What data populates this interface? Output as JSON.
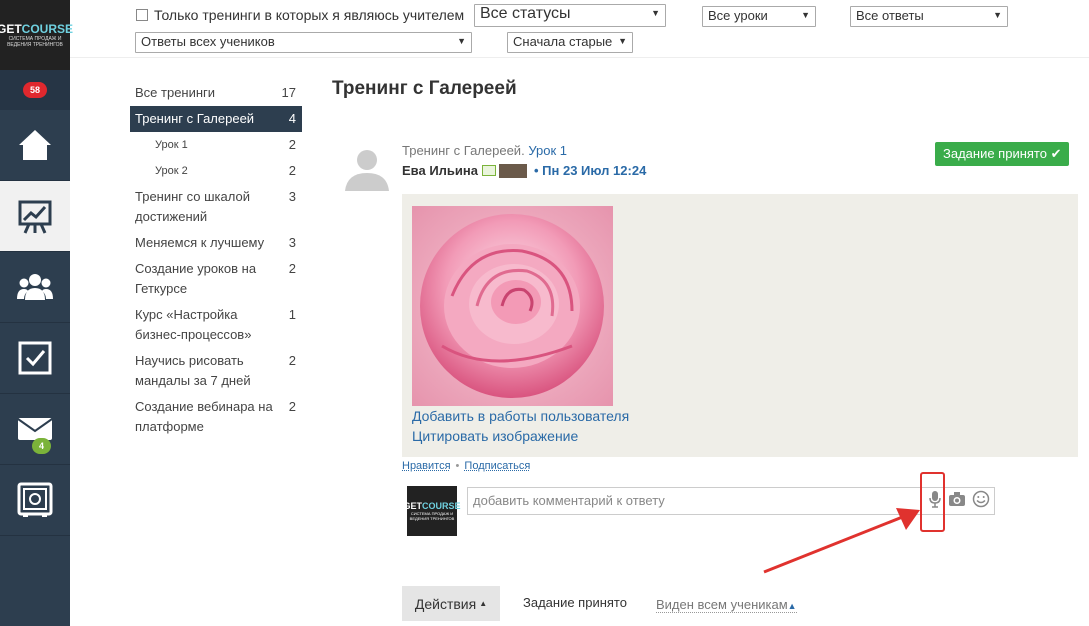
{
  "sidebar": {
    "logo_main": "GET",
    "logo_accent": "COURSE",
    "logo_sub": "СИСТЕМА ПРОДАЖ И ВЕДЕНИЯ ТРЕНИНГОВ",
    "notifications_count": "58",
    "mail_count": "4",
    "items": [
      {
        "icon": "home-icon"
      },
      {
        "icon": "chart-board-icon"
      },
      {
        "icon": "users-icon"
      },
      {
        "icon": "checkbox-icon"
      },
      {
        "icon": "mail-icon"
      },
      {
        "icon": "safe-icon"
      }
    ]
  },
  "filters": {
    "teacher_only_label": "Только тренинги в которых я являюсь учителем",
    "status": "Все статусы",
    "lessons": "Все уроки",
    "answers": "Все ответы",
    "students": "Ответы всех учеников",
    "sort": "Сначала старые"
  },
  "trainings": [
    {
      "label": "Все тренинги",
      "count": "17"
    },
    {
      "label": "Тренинг с Галереей",
      "count": "4"
    },
    {
      "label": "Урок 1",
      "count": "2"
    },
    {
      "label": "Урок 2",
      "count": "2"
    },
    {
      "label": "Тренинг со шкалой достижений",
      "count": "3"
    },
    {
      "label": "Меняемся к лучшему",
      "count": "3"
    },
    {
      "label": "Создание уроков на Геткурсе",
      "count": "2"
    },
    {
      "label": "Курс «Настройка бизнес-процессов»",
      "count": "1"
    },
    {
      "label": "Научись рисовать мандалы за 7 дней",
      "count": "2"
    },
    {
      "label": "Создание вебинара на платформе",
      "count": "2"
    }
  ],
  "page_title": "Тренинг с Галереей",
  "answer": {
    "training": "Тренинг с Галереей.",
    "lesson": "Урок 1",
    "author": "Ева Ильина",
    "datetime": "• Пн 23 Июл 12:24",
    "status_badge": "Задание принято ✔",
    "add_to_works": "Добавить в работы пользователя",
    "quote_image": "Цитировать изображение",
    "like": "Нравится",
    "dot": "•",
    "subscribe": "Подписаться",
    "comment_placeholder": "добавить комментарий к ответу"
  },
  "bottom": {
    "actions": "Действия",
    "status": "Задание принято",
    "visibility": "Виден всем ученикам"
  }
}
